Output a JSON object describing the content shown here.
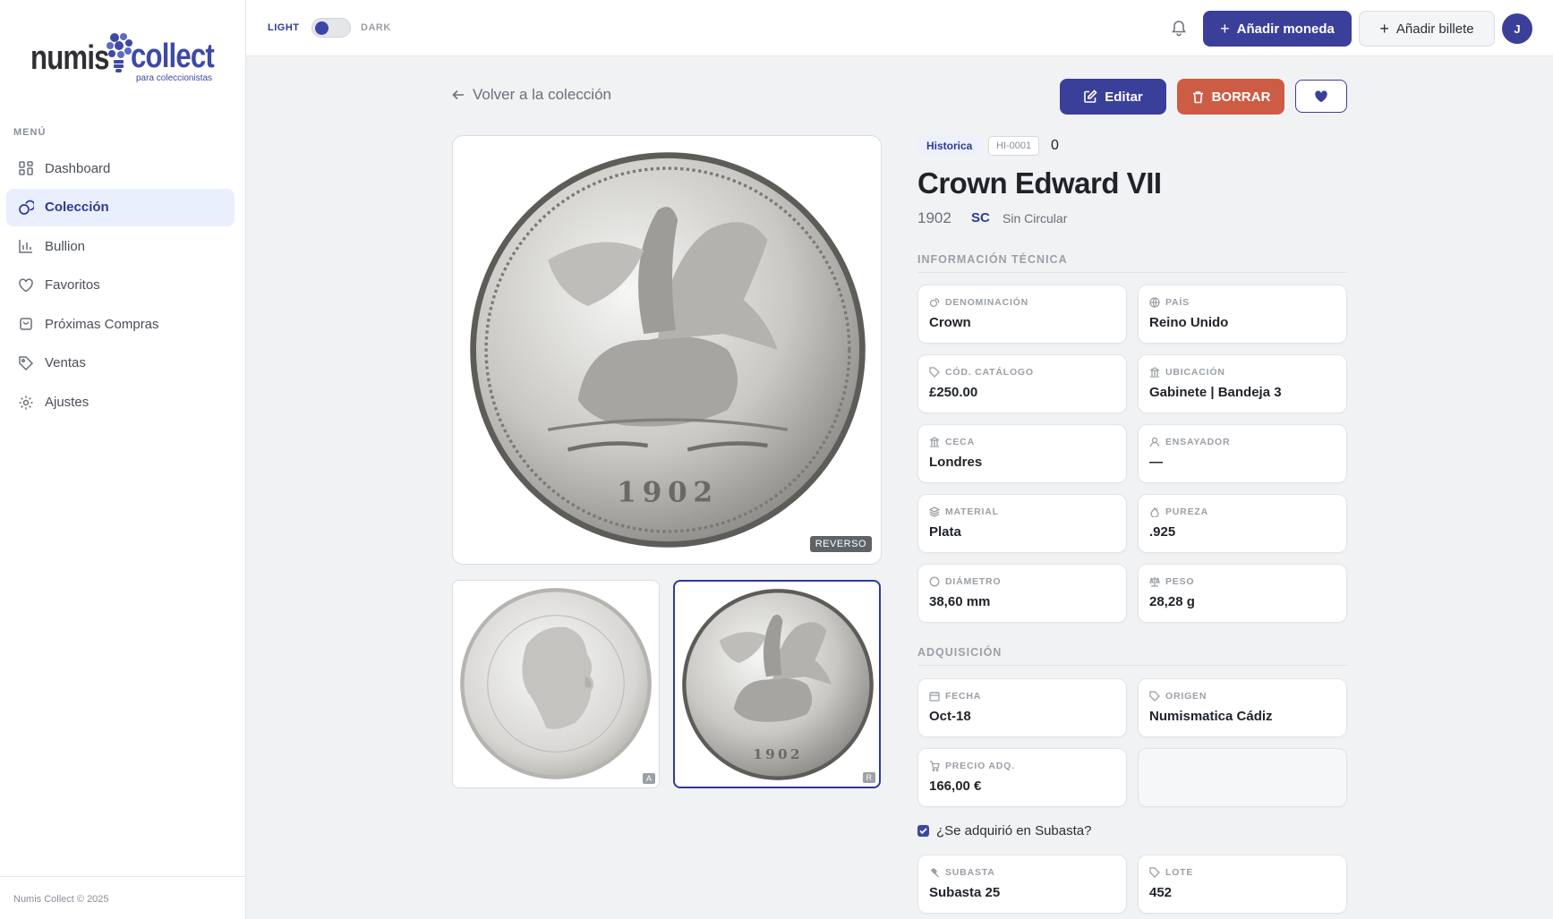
{
  "sidebar": {
    "logo": {
      "part1": "numis",
      "part2": "collect",
      "tagline": "para coleccionistas"
    },
    "menu_heading": "MENÚ",
    "items": [
      {
        "label": "Dashboard",
        "icon": "dashboard-icon"
      },
      {
        "label": "Colección",
        "icon": "coins-icon",
        "active": true
      },
      {
        "label": "Bullion",
        "icon": "chart-bar-icon"
      },
      {
        "label": "Favoritos",
        "icon": "heart-icon"
      },
      {
        "label": "Próximas Compras",
        "icon": "shopping-bag-icon"
      },
      {
        "label": "Ventas",
        "icon": "tag-icon"
      },
      {
        "label": "Ajustes",
        "icon": "gear-icon"
      }
    ],
    "footer": "Numis Collect © 2025"
  },
  "topbar": {
    "theme_light": "LIGHT",
    "theme_dark": "DARK",
    "add_coin": "Añadir moneda",
    "add_note": "Añadir billete",
    "avatar_initial": "J"
  },
  "detail": {
    "back_label": "Volver a la colección",
    "edit_label": "Editar",
    "delete_label": "BORRAR",
    "image_badge": "REVERSO",
    "thumb_a": "A",
    "thumb_r": "R",
    "category": "Historica",
    "code": "HI-0001",
    "quantity": "0",
    "title": "Crown Edward VII",
    "year": "1902",
    "grade": "SC",
    "grade_desc": "Sin Circular",
    "tech_heading": "INFORMACIÓN TÉCNICA",
    "tech": [
      {
        "label": "DENOMINACIÓN",
        "value": "Crown",
        "icon": "coins-icon"
      },
      {
        "label": "PAÍS",
        "value": "Reino Unido",
        "icon": "globe-icon"
      },
      {
        "label": "CÓD. CATÁLOGO",
        "value": "£250.00",
        "icon": "tag-icon"
      },
      {
        "label": "UBICACIÓN",
        "value": "Gabinete | Bandeja 3",
        "icon": "building-icon"
      },
      {
        "label": "CECA",
        "value": "Londres",
        "icon": "building-icon"
      },
      {
        "label": "ENSAYADOR",
        "value": "—",
        "icon": "user-icon"
      },
      {
        "label": "MATERIAL",
        "value": "Plata",
        "icon": "layers-icon"
      },
      {
        "label": "PUREZA",
        "value": ".925",
        "icon": "flame-icon"
      },
      {
        "label": "DIÁMETRO",
        "value": "38,60 mm",
        "icon": "circle-icon"
      },
      {
        "label": "PESO",
        "value": "28,28 g",
        "icon": "scale-icon"
      }
    ],
    "acq_heading": "ADQUISICIÓN",
    "acq": [
      {
        "label": "FECHA",
        "value": "Oct-18",
        "icon": "calendar-icon"
      },
      {
        "label": "ORIGEN",
        "value": "Numismatica Cádiz",
        "icon": "tag-icon"
      },
      {
        "label": "PRECIO ADQ.",
        "value": "166,00 €",
        "icon": "cart-icon"
      }
    ],
    "auction_check_label": "¿Se adquirió en Subasta?",
    "auction": [
      {
        "label": "SUBASTA",
        "value": "Subasta 25",
        "icon": "gavel-icon"
      },
      {
        "label": "LOTE",
        "value": "452",
        "icon": "tag-icon"
      }
    ]
  },
  "colors": {
    "accent": "#3a3f9a",
    "danger": "#cd5c45",
    "active_bg": "#e9effc"
  }
}
